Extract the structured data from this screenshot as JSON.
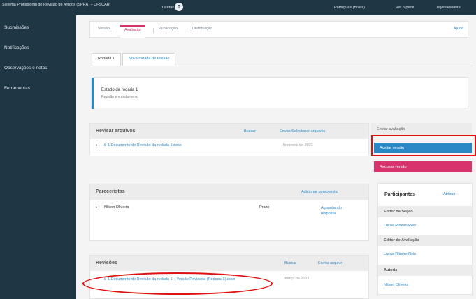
{
  "topbar": {
    "app_title": "Sistema Profissional de Revisão de Artigos (SPRA) – UFSCAR",
    "tasks_label": "Tarefas",
    "tasks_count": "0",
    "language": "Português (Brasil)",
    "view_profile": "Ver o perfil",
    "username": "rayssaoliveira"
  },
  "sidebar": {
    "items": [
      "Submissões",
      "Notificações",
      "Observações e notas",
      "Ferramentas"
    ]
  },
  "header": {
    "tabs": [
      "Versão",
      "Avaliação",
      "Publicação",
      "Distribuição"
    ],
    "active_tab_index": 1,
    "help": "Ajuda"
  },
  "round_tabs": [
    "Rodada 1",
    "Nova rodada de revisão"
  ],
  "round": {
    "title": "Estado da rodada 1",
    "status": "Revisão em andamento"
  },
  "review_files": {
    "title": "Revisar arquivos",
    "search": "Buscar",
    "upload": "Enviar/Selecionar arquivos",
    "file_name": "8-1 Documento de Revisão da rodada 1.docx",
    "file_date": "fevereiro de 2021"
  },
  "actions": {
    "head": "Enviar avaliação",
    "accept": "Aceitar versão",
    "decline": "Recusar versão"
  },
  "reviewers": {
    "title": "Pareceristas",
    "add": "Adicionar parecerista",
    "name": "Nilson Oliveira",
    "due": "Prazo",
    "status": "Aguardando resposta"
  },
  "participants": {
    "title": "Participantes",
    "assign": "Atribuir",
    "groups": [
      {
        "name": "Editor da Seção",
        "member": "Lucas Ribeiro Reis"
      },
      {
        "name": "Editor de Avaliação",
        "member": "Lucas Ribeiro Reis"
      },
      {
        "name": "Autoria",
        "member": "Nilson Oliveira"
      }
    ]
  },
  "revisions": {
    "title": "Revisões",
    "search": "Buscar",
    "upload": "Enviar arquivo",
    "file_name": "8-1 Documento de Revisão da rodada 1 – Versão Revisada (Rodada 1).docx",
    "file_date": "março de 2021"
  },
  "colors": {
    "sidebar_bg": "#1f3645",
    "accent_pink": "#d8336d",
    "accent_blue": "#2b88c7",
    "highlight_red": "#e01010"
  }
}
